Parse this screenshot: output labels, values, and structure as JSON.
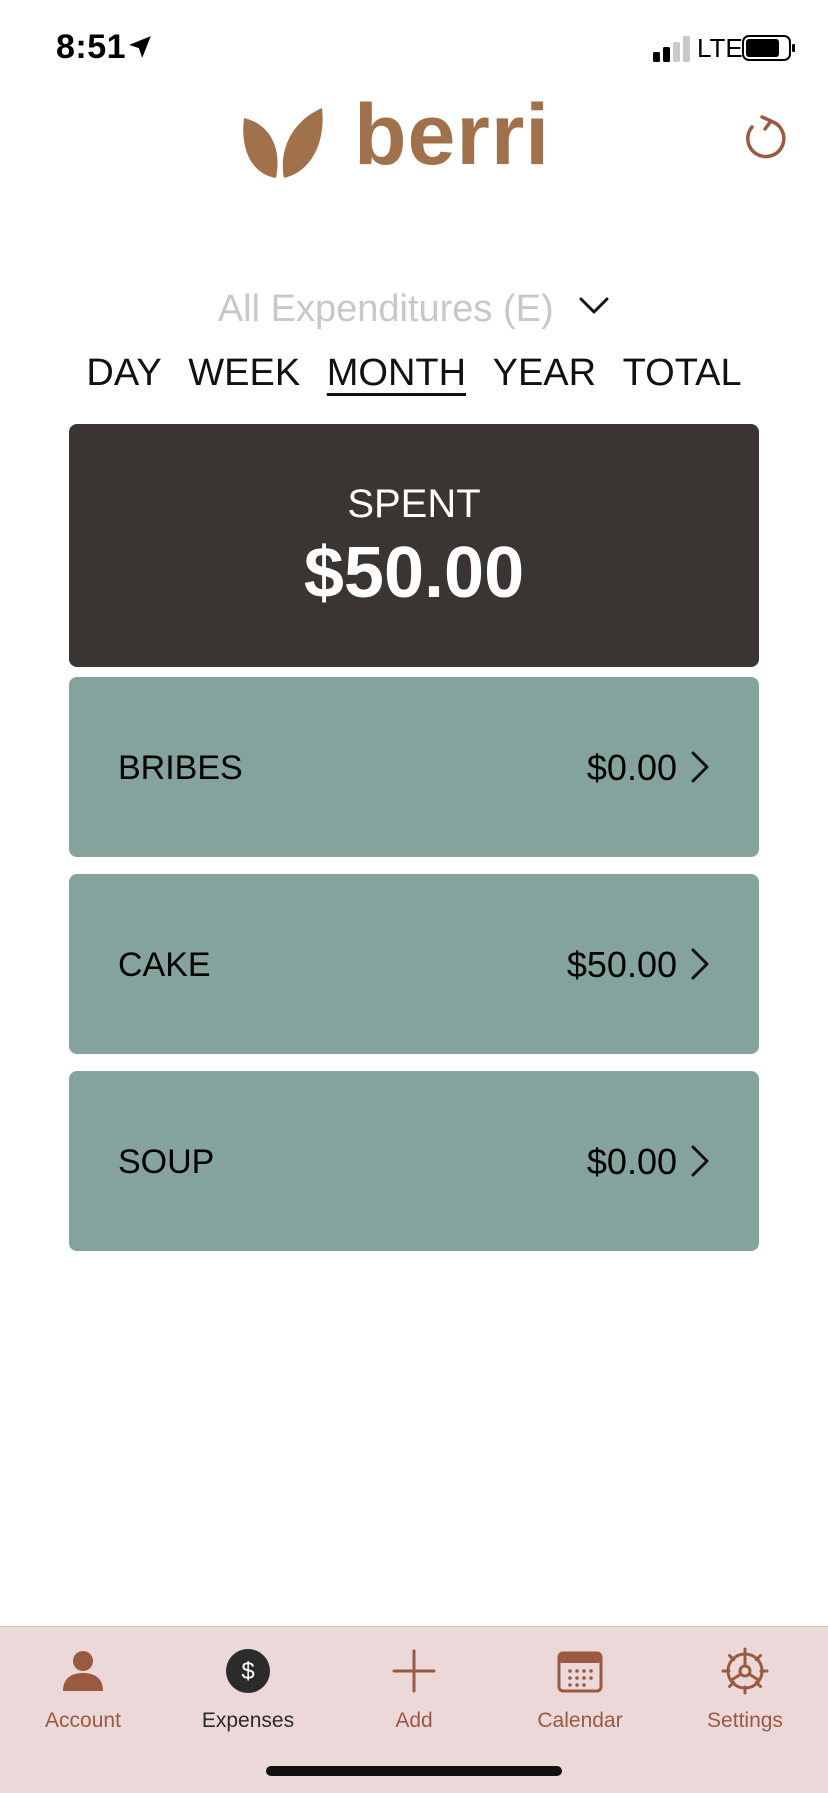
{
  "status_bar": {
    "time": "8:51",
    "network": "LTE"
  },
  "header": {
    "logo_text": "berri",
    "brand_color": "#a0714a",
    "refresh_icon": "refresh-icon"
  },
  "filter": {
    "label": "All Expenditures (E)"
  },
  "periods": [
    {
      "label": "DAY",
      "active": false
    },
    {
      "label": "WEEK",
      "active": false
    },
    {
      "label": "MONTH",
      "active": true
    },
    {
      "label": "YEAR",
      "active": false
    },
    {
      "label": "TOTAL",
      "active": false
    }
  ],
  "summary": {
    "label": "SPENT",
    "amount": "$50.00"
  },
  "categories": [
    {
      "name": "BRIBES",
      "amount": "$0.00"
    },
    {
      "name": "CAKE",
      "amount": "$50.00"
    },
    {
      "name": "SOUP",
      "amount": "$0.00"
    }
  ],
  "tabbar": {
    "tabs": [
      {
        "label": "Account",
        "icon": "person-icon",
        "selected": false
      },
      {
        "label": "Expenses",
        "icon": "dollar-icon",
        "selected": true
      },
      {
        "label": "Add",
        "icon": "plus-icon",
        "selected": false
      },
      {
        "label": "Calendar",
        "icon": "calendar-icon",
        "selected": false
      },
      {
        "label": "Settings",
        "icon": "gear-icon",
        "selected": false
      }
    ]
  },
  "colors": {
    "card_dark": "#3a3533",
    "card_category": "#84a39c",
    "tabbar_bg": "#ecd8d8",
    "accent": "#9a5a40"
  }
}
